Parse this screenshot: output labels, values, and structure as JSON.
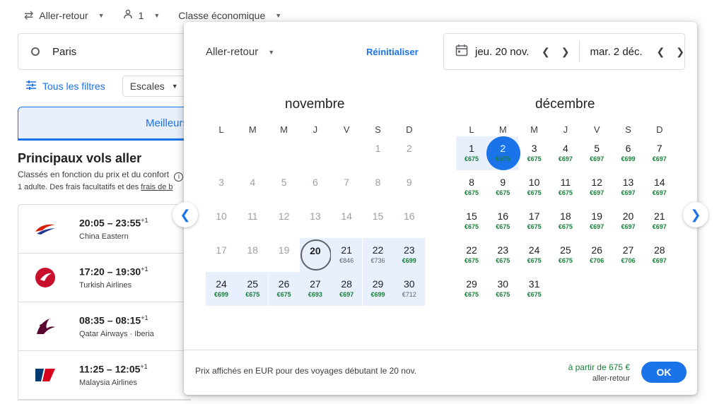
{
  "topbar": {
    "trip_type": "Aller-retour",
    "passengers": "1",
    "cabin_class": "Classe économique"
  },
  "search": {
    "origin": "Paris"
  },
  "filters": {
    "all_filters": "Tous les filtres",
    "stops": "Escales"
  },
  "sort_tab": {
    "label": "Meilleurs"
  },
  "results": {
    "title": "Principaux vols aller",
    "subtitle": "Classés en fonction du prix et du confort",
    "note_prefix": "1 adulte. Des frais facultatifs et des ",
    "note_link": "frais de b",
    "flights": [
      {
        "time": "20:05 – 23:55",
        "plus": "+1",
        "airline": "China Eastern",
        "logo": "china-eastern-logo"
      },
      {
        "time": "17:20 – 19:30",
        "plus": "+1",
        "airline": "Turkish Airlines",
        "logo": "turkish-airlines-logo"
      },
      {
        "time": "08:35 – 08:15",
        "plus": "+1",
        "airline": "Qatar Airways · Iberia",
        "logo": "qatar-airways-logo"
      },
      {
        "time": "11:25 – 12:05",
        "plus": "+1",
        "airline": "Malaysia Airlines",
        "logo": "malaysia-airlines-logo"
      }
    ]
  },
  "dialog": {
    "trip_type": "Aller-retour",
    "reset": "Réinitialiser",
    "departure_date": "jeu. 20 nov.",
    "return_date": "mar. 2 déc.",
    "weekdays": [
      "L",
      "M",
      "M",
      "J",
      "V",
      "S",
      "D"
    ],
    "months": [
      {
        "name": "novembre",
        "days": [
          {
            "d": "1",
            "p": ""
          },
          {
            "d": "2",
            "p": ""
          },
          {
            "d": "3",
            "p": ""
          },
          {
            "d": "4",
            "p": ""
          },
          {
            "d": "5",
            "p": ""
          },
          {
            "d": "6",
            "p": ""
          },
          {
            "d": "7",
            "p": ""
          },
          {
            "d": "8",
            "p": ""
          },
          {
            "d": "9",
            "p": ""
          },
          {
            "d": "10",
            "p": ""
          },
          {
            "d": "11",
            "p": ""
          },
          {
            "d": "12",
            "p": ""
          },
          {
            "d": "13",
            "p": ""
          },
          {
            "d": "14",
            "p": ""
          },
          {
            "d": "15",
            "p": ""
          },
          {
            "d": "16",
            "p": ""
          },
          {
            "d": "17",
            "p": ""
          },
          {
            "d": "18",
            "p": ""
          },
          {
            "d": "19",
            "p": ""
          },
          {
            "d": "20",
            "p": ""
          },
          {
            "d": "21",
            "p": "€846"
          },
          {
            "d": "22",
            "p": "€736"
          },
          {
            "d": "23",
            "p": "€699"
          },
          {
            "d": "24",
            "p": "€699"
          },
          {
            "d": "25",
            "p": "€675"
          },
          {
            "d": "26",
            "p": "€675"
          },
          {
            "d": "27",
            "p": "€693"
          },
          {
            "d": "28",
            "p": "€697"
          },
          {
            "d": "29",
            "p": "€699"
          },
          {
            "d": "30",
            "p": "€712"
          }
        ]
      },
      {
        "name": "décembre",
        "days": [
          {
            "d": "1",
            "p": "€675"
          },
          {
            "d": "2",
            "p": "€675"
          },
          {
            "d": "3",
            "p": "€675"
          },
          {
            "d": "4",
            "p": "€697"
          },
          {
            "d": "5",
            "p": "€697"
          },
          {
            "d": "6",
            "p": "€699"
          },
          {
            "d": "7",
            "p": "€697"
          },
          {
            "d": "8",
            "p": "€675"
          },
          {
            "d": "9",
            "p": "€675"
          },
          {
            "d": "10",
            "p": "€675"
          },
          {
            "d": "11",
            "p": "€675"
          },
          {
            "d": "12",
            "p": "€697"
          },
          {
            "d": "13",
            "p": "€697"
          },
          {
            "d": "14",
            "p": "€697"
          },
          {
            "d": "15",
            "p": "€675"
          },
          {
            "d": "16",
            "p": "€675"
          },
          {
            "d": "17",
            "p": "€675"
          },
          {
            "d": "18",
            "p": "€675"
          },
          {
            "d": "19",
            "p": "€697"
          },
          {
            "d": "20",
            "p": "€697"
          },
          {
            "d": "21",
            "p": "€697"
          },
          {
            "d": "22",
            "p": "€675"
          },
          {
            "d": "23",
            "p": "€675"
          },
          {
            "d": "24",
            "p": "€675"
          },
          {
            "d": "25",
            "p": "€675"
          },
          {
            "d": "26",
            "p": "€706"
          },
          {
            "d": "27",
            "p": "€706"
          },
          {
            "d": "28",
            "p": "€697"
          },
          {
            "d": "29",
            "p": "€675"
          },
          {
            "d": "30",
            "p": "€675"
          },
          {
            "d": "31",
            "p": "€675"
          }
        ]
      }
    ],
    "footer_note": "Prix affichés en EUR pour des voyages débutant le 20 nov.",
    "price_from": "à partir de 675 €",
    "price_type": "aller-retour",
    "ok": "OK"
  },
  "colors": {
    "accent": "#1a73e8",
    "price_green": "#188038",
    "range_bg": "#e8f0fe"
  }
}
